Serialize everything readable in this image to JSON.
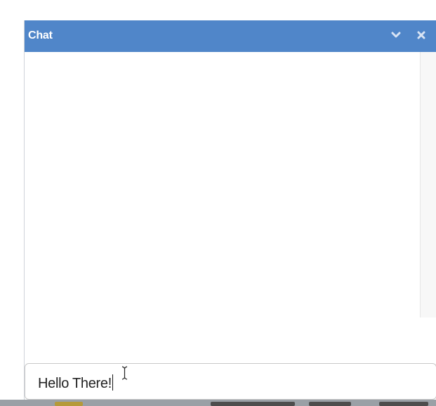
{
  "chat": {
    "title": "Chat",
    "minimize_icon": "chevron-down-icon",
    "close_icon": "close-icon",
    "input": {
      "value": "Hello There!"
    }
  },
  "colors": {
    "header_bg": "#5086c9",
    "header_text": "#ffffff",
    "input_border": "#c8c8c8"
  }
}
